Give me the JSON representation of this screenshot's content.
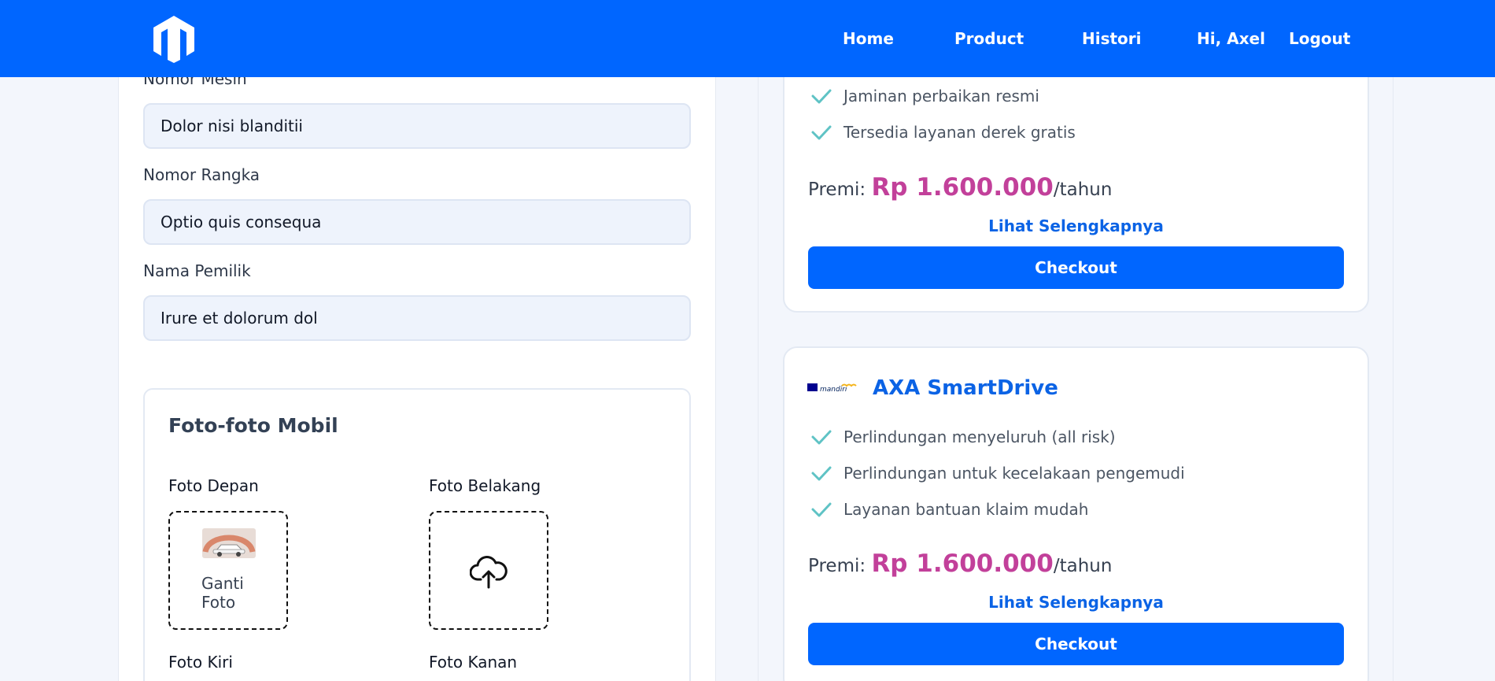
{
  "nav": {
    "logo_icon": "brand-shield-logo",
    "links": [
      "Home",
      "Product",
      "Histori"
    ],
    "greeting": "Hi, Axel",
    "logout": "Logout"
  },
  "form": {
    "fields": [
      {
        "label": "Nomor Mesin",
        "value": "Dolor nisi blanditii"
      },
      {
        "label": "Nomor Rangka",
        "value": "Optio quis consequa"
      },
      {
        "label": "Nama Pemilik",
        "value": "Irure et dolorum dol"
      }
    ],
    "photos": {
      "title": "Foto-foto Mobil",
      "items": [
        {
          "label": "Foto Depan",
          "state": "uploaded",
          "action": "Ganti Foto"
        },
        {
          "label": "Foto Belakang",
          "state": "empty",
          "icon": "cloud-upload-icon"
        },
        {
          "label": "Foto Kiri"
        },
        {
          "label": "Foto Kanan"
        }
      ]
    }
  },
  "products": [
    {
      "features": [
        "Jaminan perbaikan resmi",
        "Tersedia layanan derek gratis"
      ],
      "premi_label": "Premi:",
      "price": "Rp 1.600.000",
      "period": "/tahun",
      "more": "Lihat Selengkapnya",
      "checkout": "Checkout"
    },
    {
      "brand_logo": "axa mandiri",
      "name": "AXA SmartDrive",
      "features": [
        "Perlindungan menyeluruh (all risk)",
        "Perlindungan untuk kecelakaan pengemudi",
        "Layanan bantuan klaim mudah"
      ],
      "premi_label": "Premi:",
      "price": "Rp 1.600.000",
      "period": "/tahun",
      "more": "Lihat Selengkapnya",
      "checkout": "Checkout"
    }
  ],
  "colors": {
    "primary": "#0066ff",
    "price": "#c2409a",
    "check": "#5fc3c5",
    "background": "#f3f6fc"
  }
}
